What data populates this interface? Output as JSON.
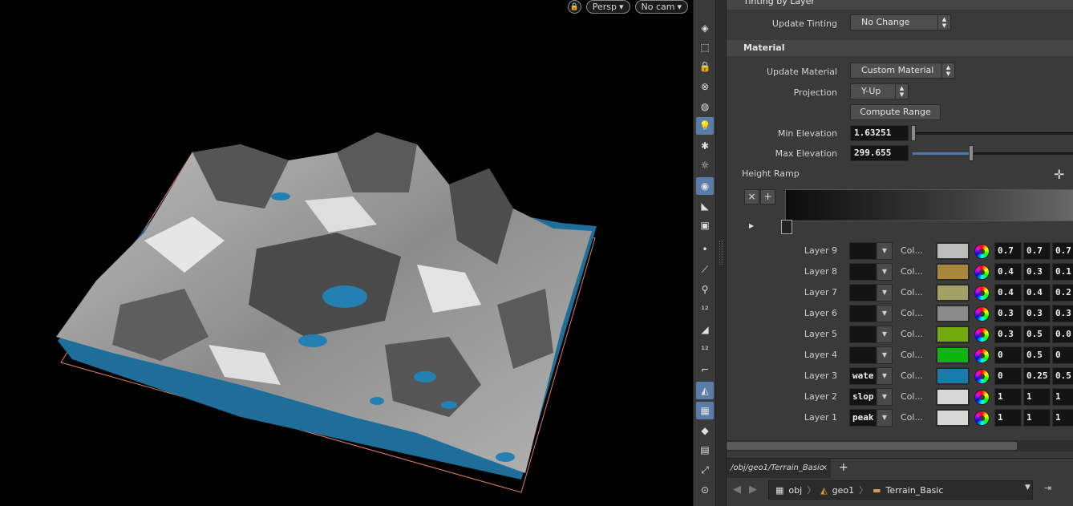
{
  "viewport": {
    "camera_type": "Persp",
    "camera": "No cam",
    "lock_icon": "lock-icon"
  },
  "params": {
    "tint_section": "Tinting by Layer",
    "update_tinting_label": "Update Tinting",
    "update_tinting_value": "No Change",
    "material_section": "Material",
    "update_material_label": "Update Material",
    "update_material_value": "Custom Material",
    "projection_label": "Projection",
    "projection_value": "Y-Up",
    "compute_range": "Compute Range",
    "min_elev_label": "Min Elevation",
    "min_elev_value": "1.63251",
    "max_elev_label": "Max Elevation",
    "max_elev_value": "299.655",
    "height_ramp_label": "Height Ramp",
    "ramp_remove": "×",
    "ramp_add": "+",
    "layers": [
      {
        "label": "Layer 9",
        "name": "",
        "col": "Col...",
        "swatch": "#bdbdbd",
        "r": "0.7",
        "g": "0.7",
        "b": "0.7"
      },
      {
        "label": "Layer 8",
        "name": "",
        "col": "Col...",
        "swatch": "#a8873a",
        "r": "0.4",
        "g": "0.3",
        "b": "0.1"
      },
      {
        "label": "Layer 7",
        "name": "",
        "col": "Col...",
        "swatch": "#a4a066",
        "r": "0.4",
        "g": "0.4",
        "b": "0.2"
      },
      {
        "label": "Layer 6",
        "name": "",
        "col": "Col...",
        "swatch": "#8a8a8a",
        "r": "0.3",
        "g": "0.3",
        "b": "0.3"
      },
      {
        "label": "Layer 5",
        "name": "",
        "col": "Col...",
        "swatch": "#72aa10",
        "r": "0.3",
        "g": "0.5",
        "b": "0.0"
      },
      {
        "label": "Layer 4",
        "name": "",
        "col": "Col...",
        "swatch": "#0fb50f",
        "r": "0",
        "g": "0.5",
        "b": "0"
      },
      {
        "label": "Layer 3",
        "name": "wate",
        "col": "Col...",
        "swatch": "#1a7aaa",
        "r": "0",
        "g": "0.25",
        "b": "0.5"
      },
      {
        "label": "Layer 2",
        "name": "slop",
        "col": "Col...",
        "swatch": "#d8d8d8",
        "r": "1",
        "g": "1",
        "b": "1"
      },
      {
        "label": "Layer 1",
        "name": "peak",
        "col": "Col...",
        "swatch": "#d8d8d8",
        "r": "1",
        "g": "1",
        "b": "1"
      }
    ]
  },
  "network": {
    "tab_path": "/obj/geo1/Terrain_Basic",
    "tab_close": "×",
    "new_tab": "+",
    "crumbs": [
      "obj",
      "geo1",
      "Terrain_Basic"
    ]
  }
}
